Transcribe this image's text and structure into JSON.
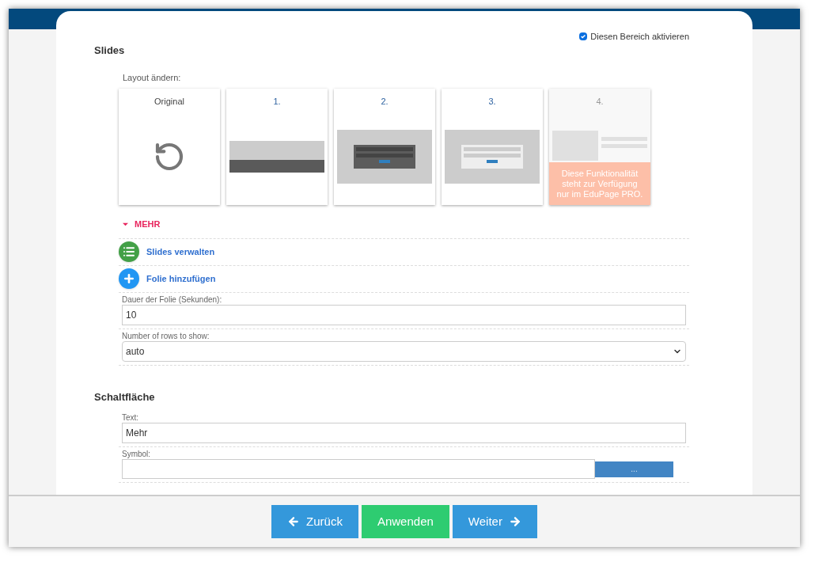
{
  "activate": {
    "label": "Diesen Bereich aktivieren",
    "checked": true
  },
  "slides": {
    "title": "Slides",
    "layout_label": "Layout ändern:",
    "layouts": [
      {
        "kind": "original",
        "label": "Original",
        "disabled": false
      },
      {
        "kind": "banner",
        "label": "1.",
        "disabled": false
      },
      {
        "kind": "dark-box",
        "label": "2.",
        "disabled": false
      },
      {
        "kind": "light-box",
        "label": "3.",
        "disabled": false
      },
      {
        "kind": "split",
        "label": "4.",
        "disabled": true,
        "notice": "Diese Funktionalität steht zur Verfügung nur im EduPage PRO."
      }
    ],
    "more": {
      "label": "MEHR",
      "expanded": true
    },
    "actions": [
      {
        "kind": "list",
        "label": "Slides verwalten"
      },
      {
        "kind": "add",
        "label": "Folie hinzufügen"
      }
    ],
    "fields": [
      {
        "kind": "input",
        "label": "Dauer der Folie (Sekunden):",
        "value": "10"
      },
      {
        "kind": "select",
        "label": "Number of rows to show:",
        "value": "auto"
      }
    ]
  },
  "button_section": {
    "title": "Schaltfläche",
    "fields": [
      {
        "kind": "input",
        "label": "Text:",
        "value": "Mehr"
      },
      {
        "kind": "picker",
        "label": "Symbol:",
        "button": "..."
      }
    ]
  },
  "footer": {
    "buttons": [
      {
        "kind": "back",
        "label": "Zurück"
      },
      {
        "kind": "apply",
        "label": "Anwenden"
      },
      {
        "kind": "next",
        "label": "Weiter"
      }
    ]
  }
}
